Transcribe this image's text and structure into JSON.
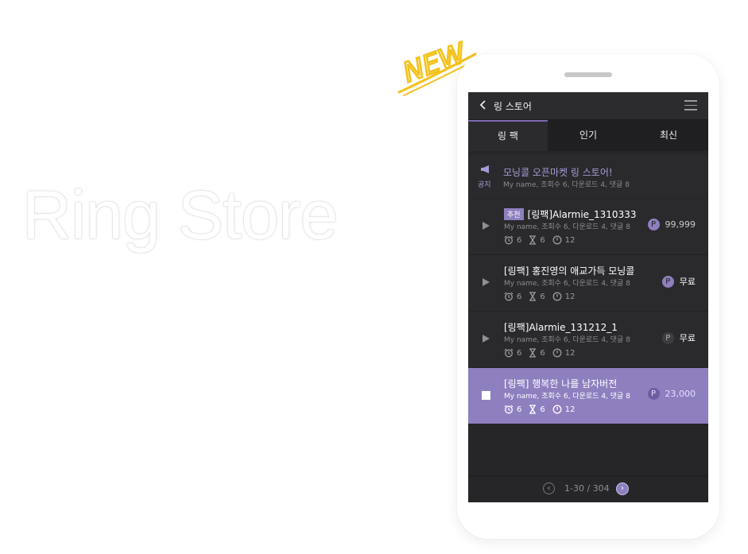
{
  "hero": {
    "title": "Ring Store",
    "badge": "NEW"
  },
  "header": {
    "back_icon": "chevron-left-icon",
    "title": "링 스토어",
    "menu_icon": "hamburger-menu-icon"
  },
  "tabs": [
    {
      "label": "링 팩",
      "active": true
    },
    {
      "label": "인기",
      "active": false
    },
    {
      "label": "최신",
      "active": false
    }
  ],
  "notice": {
    "label": "공지",
    "title": "모닝콜 오픈마켓 링 스토어!",
    "meta": "My name, 조회수 6, 다운로드 4, 댓글 8"
  },
  "items": [
    {
      "badge": "추천",
      "title": "[링팩]Alarmie_1310333",
      "meta": "My name, 조회수 6, 다운로드 4, 댓글 8",
      "alarms": "6",
      "duration": "6",
      "time": "12",
      "price": "99,999",
      "price_icon": "P",
      "playing": false
    },
    {
      "badge": "",
      "title": "[링팩] 홍진영의 애교가득 모닝콜",
      "meta": "My name, 조회수 6, 다운로드 4, 댓글 8",
      "alarms": "6",
      "duration": "6",
      "time": "12",
      "price": "무료",
      "price_icon": "P",
      "playing": false
    },
    {
      "badge": "",
      "title": "[링팩]Alarmie_131212_1",
      "meta": "My name, 조회수 6, 다운로드 4, 댓글 8",
      "alarms": "6",
      "duration": "6",
      "time": "12",
      "price": "무료",
      "price_icon": "P",
      "playing": false
    },
    {
      "badge": "",
      "title": "[링팩] 행복한 나를 남자버전",
      "meta": "My name, 조회수 6, 다운로드 4, 댓글 8",
      "alarms": "6",
      "duration": "6",
      "time": "12",
      "price": "23,000",
      "price_icon": "P",
      "playing": true
    }
  ],
  "pager": {
    "text": "1-30 / 304"
  },
  "colors": {
    "accent": "#8e7fbf",
    "badge_yellow": "#f3c21a",
    "screen_bg": "#262628"
  }
}
